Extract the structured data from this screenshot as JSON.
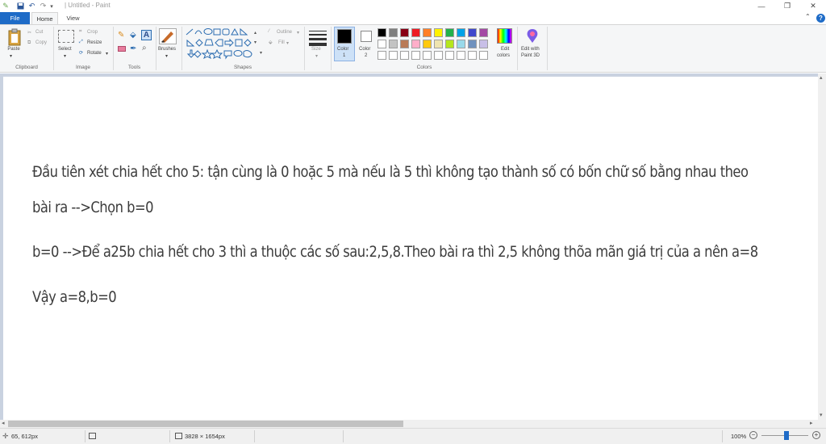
{
  "window": {
    "title": "| Untitled - Paint",
    "minimize_icon": "minimize-icon",
    "maximize_icon": "maximize-icon",
    "close_icon": "close-icon"
  },
  "tabs": {
    "file": "File",
    "home": "Home",
    "view": "View"
  },
  "ribbon": {
    "clipboard": {
      "paste": "Paste",
      "cut": "Cut",
      "copy": "Copy",
      "label": "Clipboard"
    },
    "image": {
      "select": "Select",
      "crop": "Crop",
      "resize": "Resize",
      "rotate": "Rotate",
      "label": "Image"
    },
    "tools": {
      "label": "Tools"
    },
    "brushes": {
      "label": "Brushes"
    },
    "shapes": {
      "outline": "Outline",
      "fill": "Fill",
      "label": "Shapes"
    },
    "size": {
      "label": "Size"
    },
    "colors": {
      "color1_line1": "Color",
      "color1_line2": "1",
      "color2_line1": "Color",
      "color2_line2": "2",
      "edit_line1": "Edit",
      "edit_line2": "colors",
      "paint3d_line1": "Edit with",
      "paint3d_line2": "Paint 3D",
      "label": "Colors",
      "color1_value": "#000000",
      "color2_value": "#ffffff",
      "palette_row1": [
        "#000000",
        "#7f7f7f",
        "#880015",
        "#ed1c24",
        "#ff7f27",
        "#fff200",
        "#22b14c",
        "#00a2e8",
        "#3f48cc",
        "#a349a4"
      ],
      "palette_row2": [
        "#ffffff",
        "#c3c3c3",
        "#b97a57",
        "#ffaec9",
        "#ffc90e",
        "#efe4b0",
        "#b5e61d",
        "#99d9ea",
        "#7092be",
        "#c8bfe7"
      ],
      "palette_row3": [
        "#ffffff",
        "#ffffff",
        "#ffffff",
        "#ffffff",
        "#ffffff",
        "#ffffff",
        "#ffffff",
        "#ffffff",
        "#ffffff",
        "#ffffff"
      ]
    }
  },
  "canvas": {
    "lines": [
      "Đầu tiên xét chia hết cho 5: tận cùng là 0 hoặc 5 mà nếu là 5 thì không tạo thành số có bốn chữ số bằng nhau theo",
      "bài ra -->Chọn b=0",
      "b=0 -->Để a25b chia hết cho 3 thì a thuộc các số sau:2,5,8.Theo bài ra thì 2,5 không thõa mãn giá trị của a nên a=8",
      "Vậy a=8,b=0"
    ]
  },
  "status": {
    "cursor_pos": "65, 612px",
    "image_size": "3828 × 1654px",
    "zoom": "100%"
  }
}
